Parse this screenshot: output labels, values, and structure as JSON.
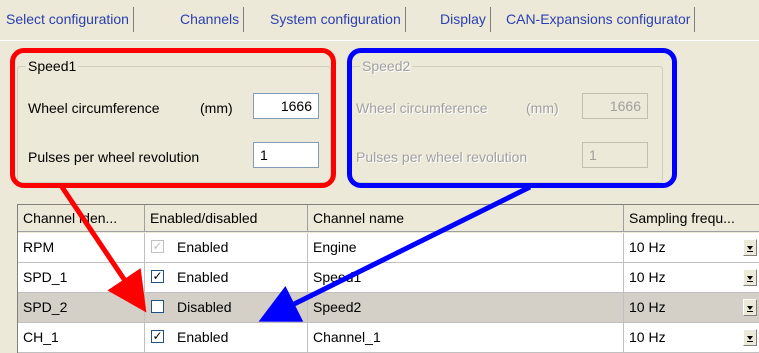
{
  "tabs": [
    {
      "label": "Select configuration",
      "active": false
    },
    {
      "label": "Channels",
      "active": true
    },
    {
      "label": "System configuration",
      "active": false
    },
    {
      "label": "Display",
      "active": false
    },
    {
      "label": "CAN-Expansions configurator",
      "active": false
    }
  ],
  "speed1": {
    "title": "Speed1",
    "circumference_label": "Wheel circumference",
    "unit": "(mm)",
    "circumference_value": "1666",
    "pulses_label": "Pulses per wheel revolution",
    "pulses_value": "1",
    "enabled": true
  },
  "speed2": {
    "title": "Speed2",
    "circumference_label": "Wheel circumference",
    "unit": "(mm)",
    "circumference_value": "1666",
    "pulses_label": "Pulses per wheel revolution",
    "pulses_value": "1",
    "enabled": false
  },
  "grid": {
    "columns": [
      "Channel iden...",
      "Enabled/disabled",
      "Channel name",
      "Sampling frequ..."
    ],
    "rows": [
      {
        "id": "RPM",
        "checked": true,
        "check_disabled": true,
        "status": "Enabled",
        "name": "Engine",
        "freq": "10 Hz",
        "selected": false
      },
      {
        "id": "SPD_1",
        "checked": true,
        "check_disabled": false,
        "status": "Enabled",
        "name": "Speed1",
        "freq": "10 Hz",
        "selected": false
      },
      {
        "id": "SPD_2",
        "checked": false,
        "check_disabled": false,
        "status": "Disabled",
        "name": "Speed2",
        "freq": "10 Hz",
        "selected": true
      },
      {
        "id": "CH_1",
        "checked": true,
        "check_disabled": false,
        "status": "Enabled",
        "name": "Channel_1",
        "freq": "10 Hz",
        "selected": false
      }
    ]
  },
  "colors": {
    "annotation_red": "#ff0000",
    "annotation_blue": "#0000ff",
    "tab_text": "#2a3fb1"
  }
}
